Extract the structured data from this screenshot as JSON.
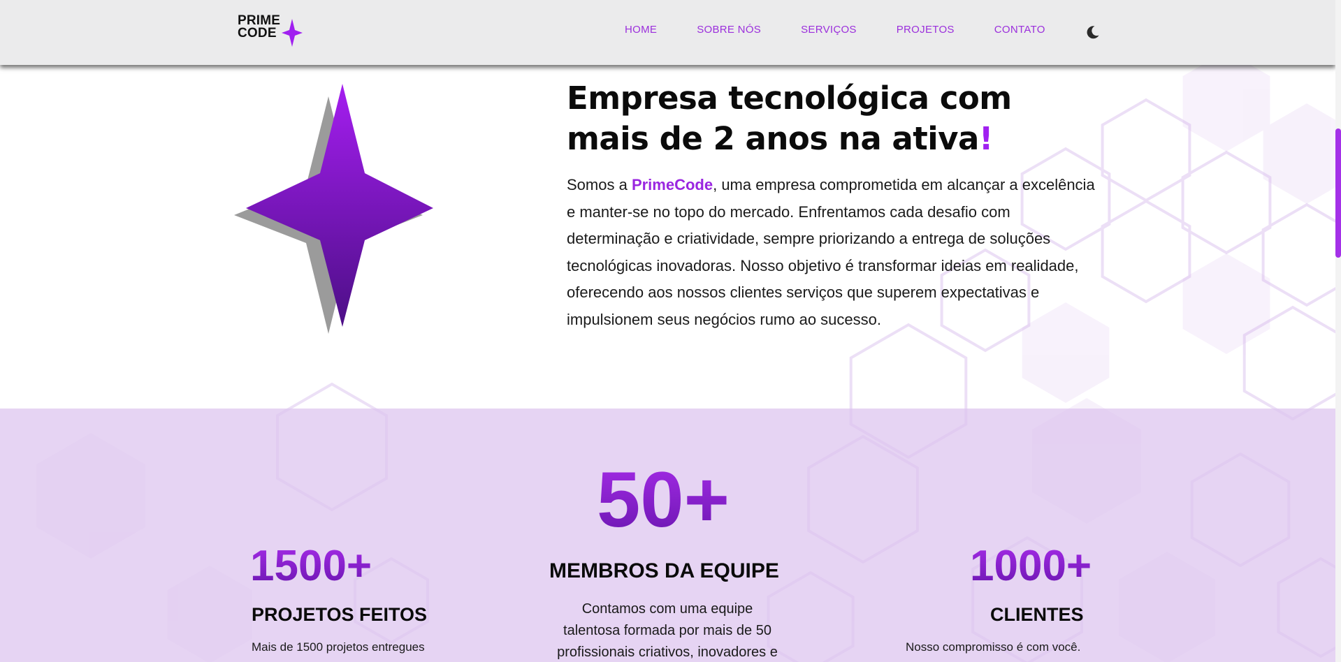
{
  "header": {
    "logo": {
      "line1": "PRIME",
      "line2": "CODE"
    },
    "nav": [
      "HOME",
      "SOBRE NÓS",
      "SERVIÇOS",
      "PROJETOS",
      "CONTATO"
    ],
    "theme_icon": "moon-icon"
  },
  "about": {
    "title_main": "Empresa tecnológica com mais de 2 anos na ativa",
    "title_excl": "!",
    "body_pre": "Somos a ",
    "brand": "PrimeCode",
    "body_post": ", uma empresa comprometida em alcançar a excelência e manter-se no topo do mercado. Enfrentamos cada desafio com determinação e criatividade, sempre priorizando a entrega de soluções tecnológicas inovadoras. Nosso objetivo é transformar ideias em realidade, oferecendo aos nossos clientes serviços que superem expectativas e impulsionem seus negócios rumo ao sucesso."
  },
  "stats": {
    "projects": {
      "number": "1500+",
      "title": "PROJETOS FEITOS",
      "desc": "Mais de 1500 projetos entregues"
    },
    "team": {
      "number": "50+",
      "title": "MEMBROS DA EQUIPE",
      "desc_lines": [
        "Contamos com uma equipe",
        "talentosa formada por mais de 50",
        "profissionais criativos, inovadores e"
      ]
    },
    "clients": {
      "number": "1000+",
      "title": "CLIENTES",
      "desc": "Nosso compromisso é com você."
    }
  },
  "colors": {
    "accent": "#a020f0",
    "nav_text": "#9b2fdc",
    "header_bg": "#ebebec",
    "stats_bg": "#e6d6f2"
  }
}
